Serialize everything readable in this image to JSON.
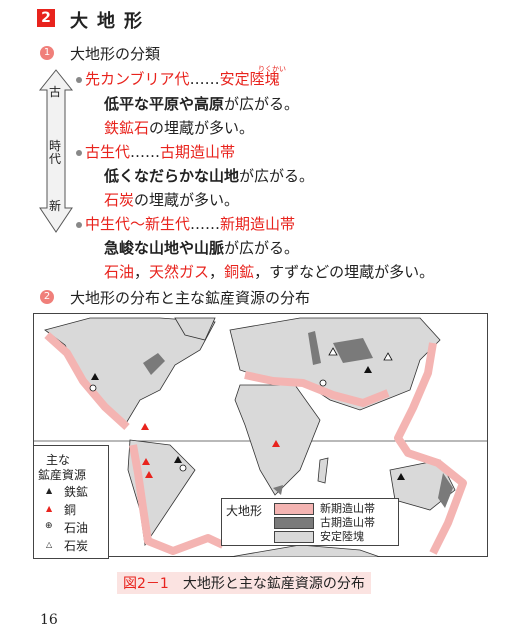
{
  "section": {
    "number": "2",
    "title": "大地形"
  },
  "subsections": [
    {
      "number": "1",
      "title": "大地形の分類"
    },
    {
      "number": "2",
      "title": "大地形の分布と主な鉱産資源の分布"
    }
  ],
  "era_arrow": {
    "top": "古",
    "middle": "時代",
    "bottom": "新"
  },
  "ruby": "りくかい",
  "items": [
    {
      "heading": [
        {
          "t": "先カンブリア代",
          "c": "red"
        },
        {
          "t": "……",
          "c": ""
        },
        {
          "t": "安定陸塊",
          "c": "red"
        }
      ],
      "lines": [
        [
          {
            "t": "低平な平原や高原",
            "c": "bold"
          },
          {
            "t": "が広がる。",
            "c": ""
          }
        ],
        [
          {
            "t": "鉄鉱石",
            "c": "red"
          },
          {
            "t": "の埋蔵が多い。",
            "c": ""
          }
        ]
      ]
    },
    {
      "heading": [
        {
          "t": "古生代",
          "c": "red"
        },
        {
          "t": "……",
          "c": ""
        },
        {
          "t": "古期造山帯",
          "c": "red"
        }
      ],
      "lines": [
        [
          {
            "t": "低くなだらかな山地",
            "c": "bold"
          },
          {
            "t": "が広がる。",
            "c": ""
          }
        ],
        [
          {
            "t": "石炭",
            "c": "red"
          },
          {
            "t": "の埋蔵が多い。",
            "c": ""
          }
        ]
      ]
    },
    {
      "heading": [
        {
          "t": "中生代～新生代",
          "c": "red"
        },
        {
          "t": "……",
          "c": ""
        },
        {
          "t": "新期造山帯",
          "c": "red"
        }
      ],
      "lines": [
        [
          {
            "t": "急峻な山地や山脈",
            "c": "bold"
          },
          {
            "t": "が広がる。",
            "c": ""
          }
        ],
        [
          {
            "t": "石油",
            "c": "red"
          },
          {
            "t": "，",
            "c": ""
          },
          {
            "t": "天然ガス",
            "c": "red"
          },
          {
            "t": "，",
            "c": ""
          },
          {
            "t": "銅鉱",
            "c": "red"
          },
          {
            "t": "，すずなどの埋蔵が多い。",
            "c": ""
          }
        ]
      ]
    }
  ],
  "resource_legend": {
    "title1": "主な",
    "title2": "鉱産資源",
    "items": [
      {
        "label": "鉄鉱",
        "icon": "black-triangle"
      },
      {
        "label": "銅",
        "icon": "red-triangle"
      },
      {
        "label": "石油",
        "icon": "oil-circle"
      },
      {
        "label": "石炭",
        "icon": "open-triangle"
      }
    ]
  },
  "landform_legend": {
    "title": "大地形",
    "items": [
      {
        "label": "新期造山帯",
        "color": "#f4b4b2"
      },
      {
        "label": "古期造山帯",
        "color": "#7a7a7a"
      },
      {
        "label": "安定陸塊",
        "color": "#d9d9d9"
      }
    ]
  },
  "caption": {
    "figure": "図2－1",
    "text": "大地形と主な鉱産資源の分布"
  },
  "page_number": "16"
}
